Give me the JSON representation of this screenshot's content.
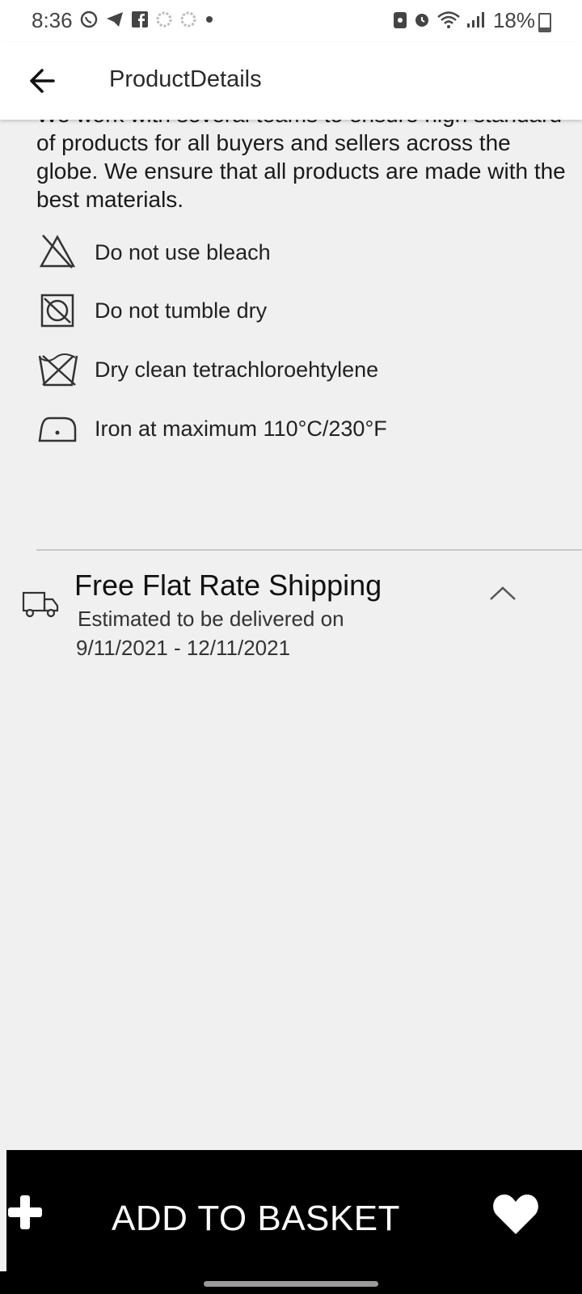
{
  "status_bar": {
    "time": "8:36",
    "battery": "18%",
    "left_icons": [
      "whatsapp-icon",
      "telegram-icon",
      "facebook-icon",
      "settings-icon",
      "settings-icon",
      "dot-icon"
    ],
    "right_icons": [
      "lock-icon",
      "alarm-icon",
      "wifi-icon",
      "signal-icon"
    ]
  },
  "app_bar": {
    "title": "ProductDetails",
    "back_icon": "arrow-left-icon"
  },
  "description": {
    "text": "We work with several teams to ensure high standard\nof products for all buyers and sellers across the\nglobe. We ensure that all products are made with the\nbest materials."
  },
  "care_instructions": [
    {
      "icon": "no-bleach-icon",
      "label": "Do not use bleach"
    },
    {
      "icon": "no-tumble-dry-icon",
      "label": "Do not tumble dry"
    },
    {
      "icon": "dry-clean-icon",
      "label": "Dry clean tetrachloroehtylene"
    },
    {
      "icon": "iron-icon",
      "label": " Iron at maximum 110°C/230°F"
    }
  ],
  "shipping": {
    "icon": "truck-icon",
    "title": "Free Flat Rate Shipping",
    "subtitle": "Estimated to be delivered on",
    "date_range": "9/11/2021 - 12/11/2021",
    "expanded": true
  },
  "bottom_bar": {
    "add_label": "ADD TO BASKET",
    "plus_icon": "plus-icon",
    "favorite_icon": "heart-icon"
  },
  "colors": {
    "background": "#f0f0f0",
    "appbar": "#ffffff",
    "bottom_bar": "#000000",
    "bottom_text": "#ffffff"
  }
}
